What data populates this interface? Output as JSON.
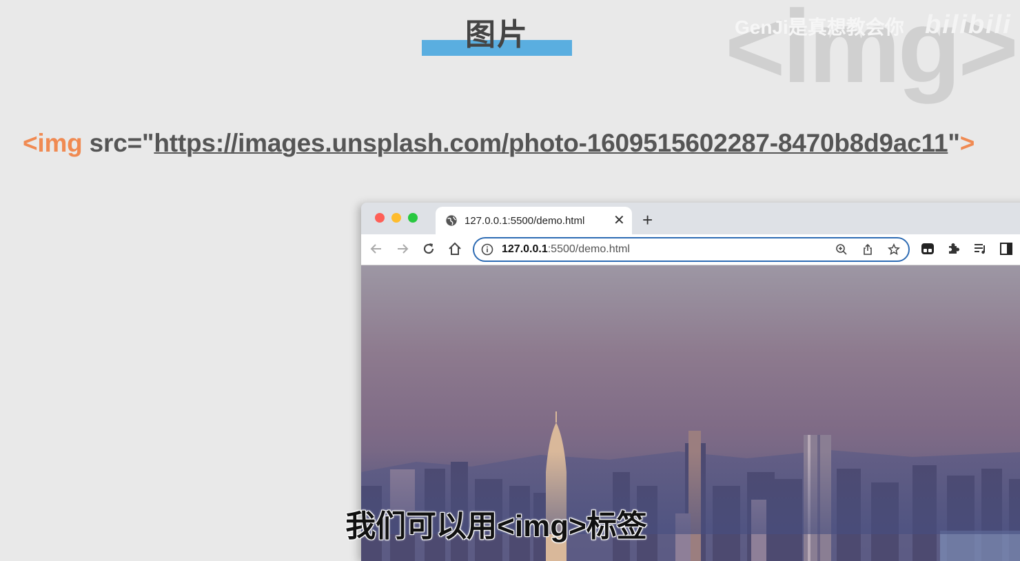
{
  "slide": {
    "title": "图片",
    "watermark_tag": "<img>",
    "watermark_author": "GenJi是真想教会你",
    "watermark_logo": "bilibili"
  },
  "code": {
    "tag_open": "<img",
    "attr": " src=\"",
    "url": "https://images.unsplash.com/photo-1609515602287-8470b8d9ac11",
    "attr_close": "\"",
    "tag_close": ">"
  },
  "browser": {
    "tab_title": "127.0.0.1:5500/demo.html",
    "address_host": "127.0.0.1",
    "address_rest": ":5500/demo.html"
  },
  "subtitle": "我们可以用<img>标签",
  "colors": {
    "accent_blue": "#5aaee0",
    "code_orange": "#f08a52",
    "address_border": "#2d6bb3"
  }
}
